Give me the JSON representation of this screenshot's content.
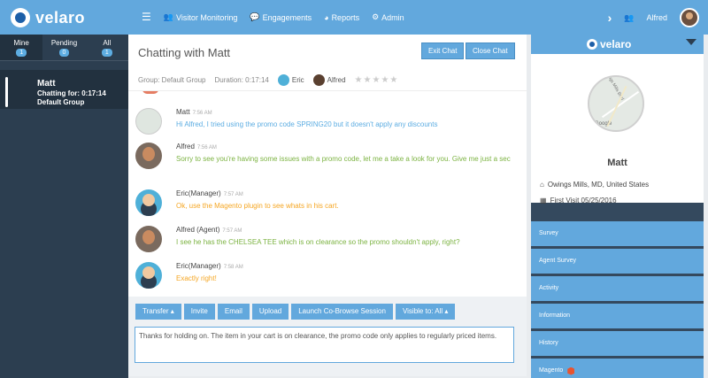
{
  "brand": {
    "name": "velaro"
  },
  "nav": {
    "items": [
      {
        "label": "Visitor Monitoring",
        "icon": "users-icon",
        "glyph": "👥"
      },
      {
        "label": "Engagements",
        "icon": "chat-icon",
        "glyph": "💬"
      },
      {
        "label": "Reports",
        "icon": "chart-icon",
        "glyph": "◕"
      },
      {
        "label": "Admin",
        "icon": "gear-icon",
        "glyph": "⚙"
      }
    ],
    "user": "Alfred"
  },
  "sidebar": {
    "tabs": [
      {
        "label": "Mine",
        "count": "1"
      },
      {
        "label": "Pending",
        "count": "0"
      },
      {
        "label": "All",
        "count": "1"
      }
    ],
    "chat": {
      "name": "Matt",
      "duration": "Chatting for: 0:17:14",
      "group": "Default Group"
    }
  },
  "chat": {
    "title": "Chatting with Matt",
    "exit_label": "Exit Chat",
    "close_label": "Close Chat",
    "group": "Group: Default Group",
    "duration": "Duration: 0:17:14",
    "participants": [
      "Eric",
      "Alfred"
    ],
    "stars": "★★★★★",
    "messages": [
      {
        "author": "Matt",
        "time": "7:56 AM",
        "text": "Hi Alfred, I tried using the promo code SPRING20 but it doesn't apply any discounts",
        "color": "#5dade2"
      },
      {
        "author": "Alfred",
        "time": "7:56 AM",
        "text": "Sorry to see you're having some issues with a promo code, let me a take a look for you. Give me just a sec",
        "color": "#7cb342"
      },
      {
        "author": "Eric(Manager)",
        "time": "7:57 AM",
        "text": "Ok, use the Magento plugin to see whats in his cart.",
        "color": "#f5a623"
      },
      {
        "author": "Alfred (Agent)",
        "time": "7:57 AM",
        "text": "I see he has the CHELSEA TEE which is on clearance so the promo shouldn't apply, right?",
        "color": "#7cb342"
      },
      {
        "author": "Eric(Manager)",
        "time": "7:58 AM",
        "text": "Exactly right!",
        "color": "#f5a623"
      }
    ],
    "toolbar": [
      "Transfer ▴",
      "Invite",
      "Email",
      "Upload",
      "Launch Co-Browse Session",
      "Visible to: All ▴"
    ],
    "draft": "Thanks for holding on. The item in your cart is on clearance, the promo code only applies to regularly priced items."
  },
  "visitor": {
    "brand": "velaro",
    "name": "Matt",
    "location": "Owings Mills, MD, United States",
    "first_visit": "First Visit 05/25/2016",
    "map_label": "Owings Mills Blvd",
    "map_brand": "Google",
    "sections": [
      "Survey",
      "Agent Survey",
      "Activity",
      "Information",
      "History",
      "Magento"
    ]
  },
  "colors": {
    "accent": "#62a8dd",
    "sidebar": "#2c3e50",
    "agent_text": "#7cb342",
    "visitor_text": "#5dade2",
    "manager_text": "#f5a623"
  }
}
